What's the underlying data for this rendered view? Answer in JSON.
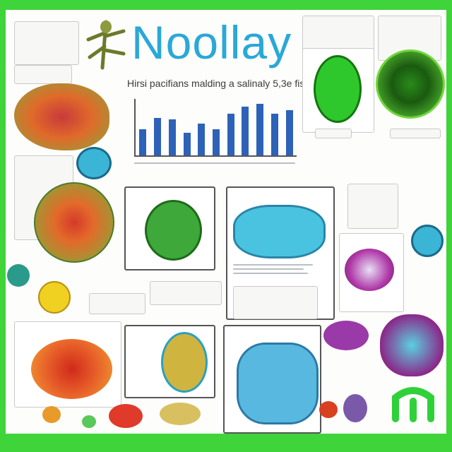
{
  "poster": {
    "title": "Noollay",
    "subtitle": "Hirsi pacifians malding a salinaly 5,3e fis"
  },
  "chart_data": {
    "type": "bar",
    "values": [
      28,
      40,
      38,
      24,
      34,
      28,
      44,
      52,
      55,
      44,
      48
    ],
    "ylim": [
      0,
      60
    ]
  },
  "colors": {
    "frame": "#3fd43a",
    "title": "#2aa8d8",
    "bars": "#2d62b8"
  }
}
